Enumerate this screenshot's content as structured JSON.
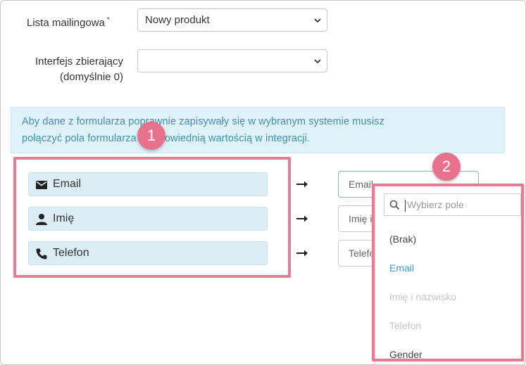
{
  "form": {
    "mailing_list": {
      "label": "Lista mailingowa",
      "required_mark": "*",
      "value": "Nowy produkt"
    },
    "collector": {
      "label_line1": "Interfejs zbierający",
      "label_line2": "(domyślnie 0)",
      "value": ""
    }
  },
  "alert": {
    "line1": "Aby dane z formularza poprawnie zapisywały się w wybranym systemie musisz",
    "line2": "połączyć pola formularza z odpowiednią wartością w integracji."
  },
  "fields": [
    {
      "label": "Email",
      "icon": "envelope-icon",
      "mapped": "Email"
    },
    {
      "label": "Imię",
      "icon": "person-icon",
      "mapped": "Imię i nazwisko"
    },
    {
      "label": "Telefon",
      "icon": "phone-icon",
      "mapped": "Telefon"
    }
  ],
  "dropdown": {
    "placeholder": "Wybierz pole",
    "options": [
      {
        "label": "(Brak)",
        "state": "normal"
      },
      {
        "label": "Email",
        "state": "selected"
      },
      {
        "label": "Imię i nazwisko",
        "state": "disabled"
      },
      {
        "label": "Telefon",
        "state": "disabled"
      },
      {
        "label": "Gender",
        "state": "normal"
      }
    ]
  },
  "badges": [
    "1",
    "2"
  ],
  "colors": {
    "highlight": "#e87b93",
    "badge": "#e8718c",
    "alert_bg": "#dff1f9",
    "alert_text": "#3f8fb3",
    "pill_bg": "#dcedf5",
    "selected_option": "#3a9bd0"
  }
}
